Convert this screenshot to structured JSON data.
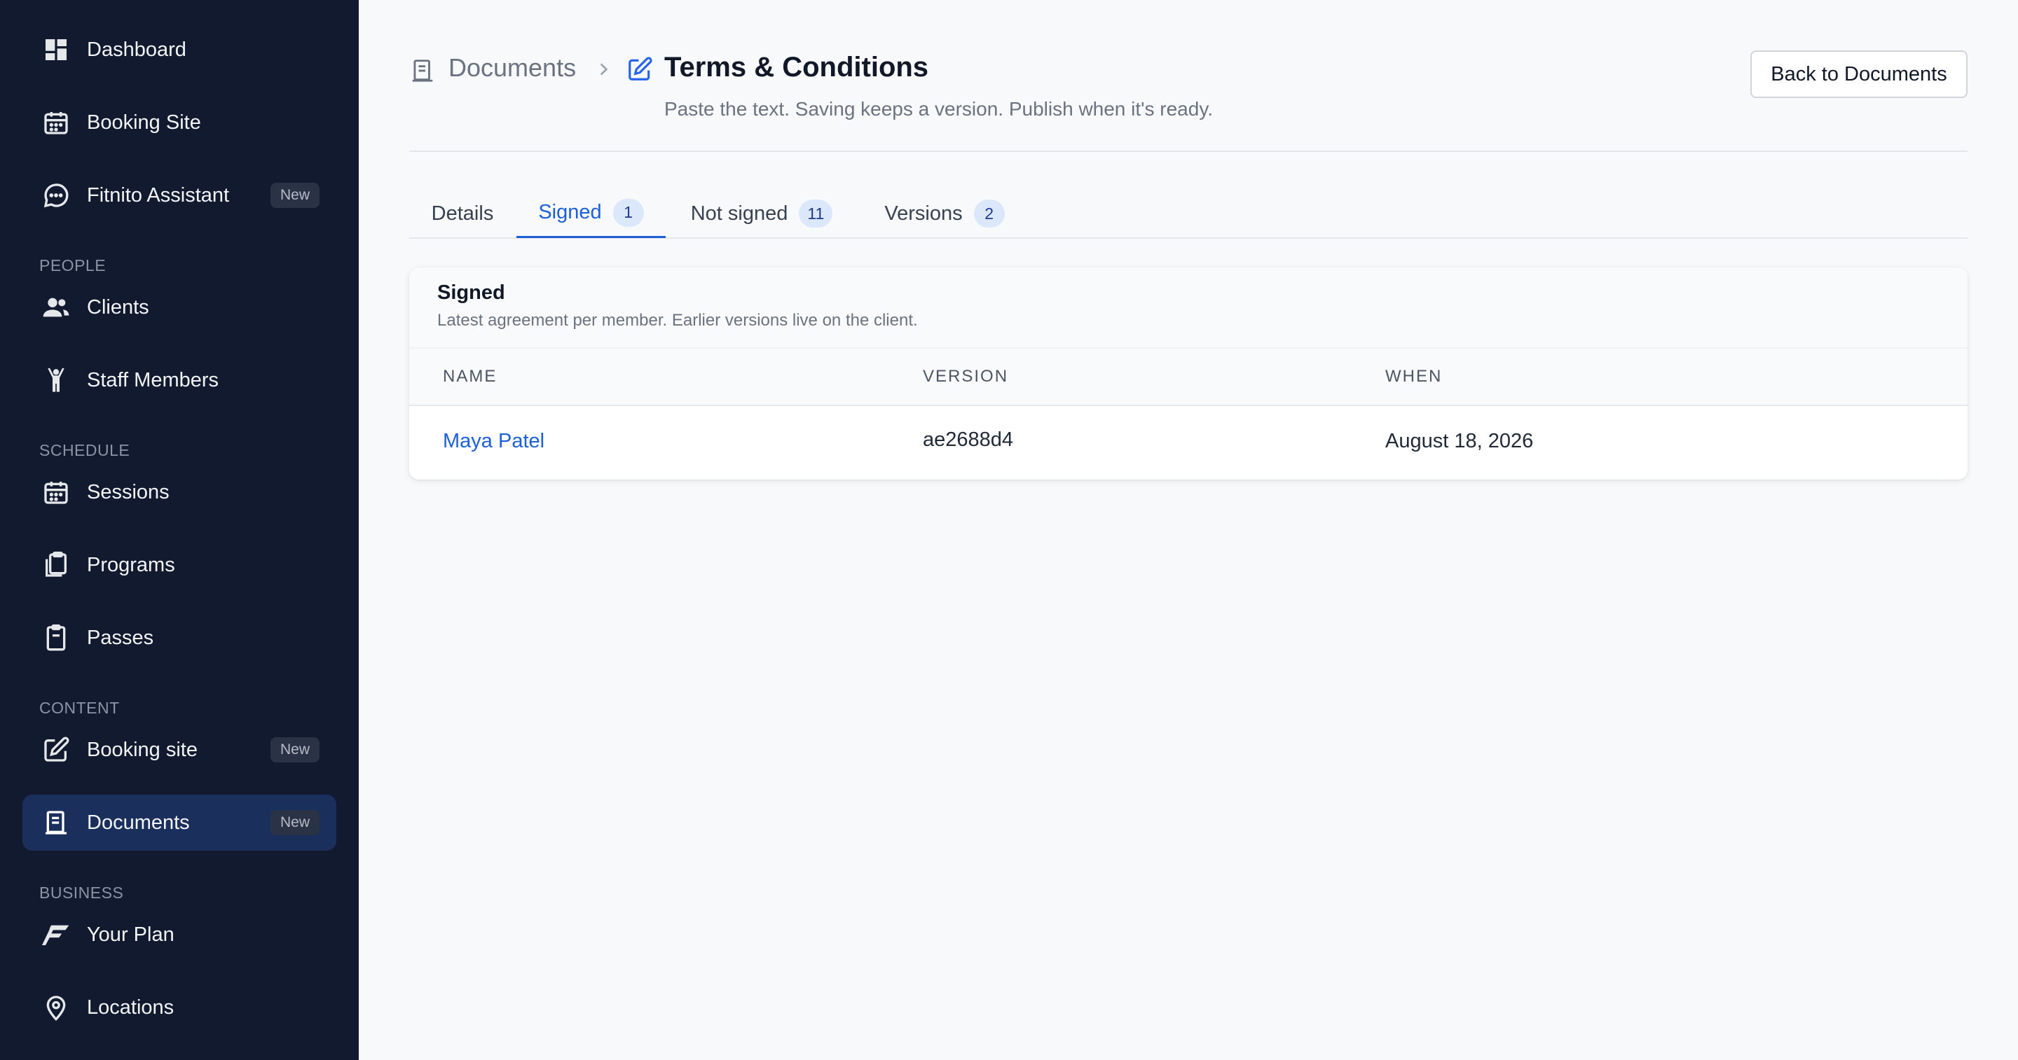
{
  "sidebar": {
    "items": [
      {
        "label": "Dashboard",
        "icon": "dashboard-icon"
      },
      {
        "label": "Booking Site",
        "icon": "calendar-icon"
      },
      {
        "label": "Fitnito Assistant",
        "icon": "chat-bubble-icon",
        "badge": "New"
      },
      {
        "label": "Clients",
        "icon": "users-icon"
      },
      {
        "label": "Staff Members",
        "icon": "staff-icon"
      },
      {
        "label": "Sessions",
        "icon": "calendar-icon"
      },
      {
        "label": "Programs",
        "icon": "clipboard-stack-icon"
      },
      {
        "label": "Passes",
        "icon": "clipboard-icon"
      },
      {
        "label": "Booking site",
        "icon": "edit-icon",
        "badge": "New"
      },
      {
        "label": "Documents",
        "icon": "document-icon",
        "badge": "New",
        "active": true
      },
      {
        "label": "Your Plan",
        "icon": "fitnito-logo-icon"
      },
      {
        "label": "Locations",
        "icon": "location-pin-icon"
      }
    ],
    "sections": {
      "people": "PEOPLE",
      "schedule": "SCHEDULE",
      "content": "CONTENT",
      "business": "BUSINESS"
    }
  },
  "breadcrumb": {
    "parent": "Documents",
    "current": "Terms & Conditions"
  },
  "page": {
    "subtitle": "Paste the text. Saving keeps a version. Publish when it's ready.",
    "back_button": "Back to Documents"
  },
  "tabs": [
    {
      "label": "Details"
    },
    {
      "label": "Signed",
      "count": "1",
      "active": true
    },
    {
      "label": "Not signed",
      "count": "11"
    },
    {
      "label": "Versions",
      "count": "2"
    }
  ],
  "signed_card": {
    "title": "Signed",
    "description": "Latest agreement per member. Earlier versions live on the client.",
    "columns": [
      "NAME",
      "VERSION",
      "WHEN"
    ],
    "rows": [
      {
        "name": "Maya Patel",
        "version": "ae2688d4",
        "when": "August 18, 2026"
      }
    ]
  },
  "colors": {
    "sidebar_bg": "#111a2e",
    "active_item_bg": "#1a2f5c",
    "accent": "#1d5fd6",
    "count_badge_bg": "#dbe7fb"
  }
}
